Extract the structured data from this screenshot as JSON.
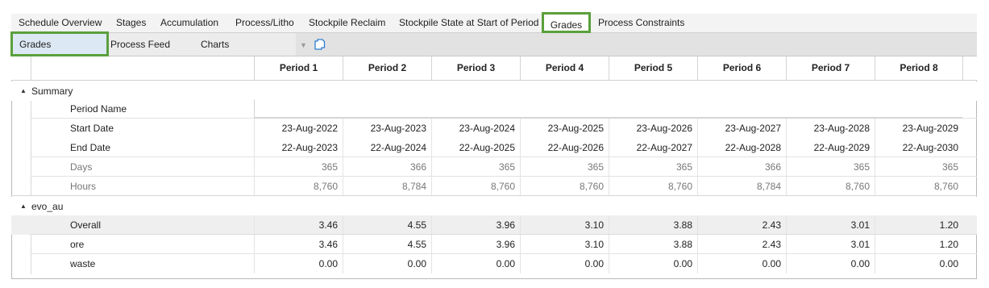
{
  "top_tabs": [
    {
      "label": "Schedule Overview",
      "active": false
    },
    {
      "label": "Stages",
      "active": false
    },
    {
      "label": "Accumulation",
      "active": false
    },
    {
      "label": "Process/Litho",
      "active": false
    },
    {
      "label": "Stockpile Reclaim",
      "active": false
    },
    {
      "label": "Stockpile State at Start of Period",
      "active": false
    },
    {
      "label": "Grades",
      "active": true
    },
    {
      "label": "Process Constraints",
      "active": false
    }
  ],
  "sub_tabs": [
    {
      "label": "Grades",
      "active": true
    },
    {
      "label": "Process Feed",
      "active": false
    },
    {
      "label": "Charts",
      "active": false
    }
  ],
  "toolbar": {
    "copy_icon": "copy-icon",
    "filter_icon": "filter-icon"
  },
  "columns": [
    "Period 1",
    "Period 2",
    "Period 3",
    "Period 4",
    "Period 5",
    "Period 6",
    "Period 7",
    "Period 8"
  ],
  "groups": {
    "summary": {
      "name": "Summary",
      "rows": {
        "period_name": {
          "label": "Period Name",
          "values": [
            "",
            "",
            "",
            "",
            "",
            "",
            "",
            ""
          ]
        },
        "start_date": {
          "label": "Start Date",
          "values": [
            "23-Aug-2022",
            "23-Aug-2023",
            "23-Aug-2024",
            "23-Aug-2025",
            "23-Aug-2026",
            "23-Aug-2027",
            "23-Aug-2028",
            "23-Aug-2029"
          ]
        },
        "end_date": {
          "label": "End Date",
          "values": [
            "22-Aug-2023",
            "22-Aug-2024",
            "22-Aug-2025",
            "22-Aug-2026",
            "22-Aug-2027",
            "22-Aug-2028",
            "22-Aug-2029",
            "22-Aug-2030"
          ]
        },
        "days": {
          "label": "Days",
          "values": [
            "365",
            "366",
            "365",
            "365",
            "365",
            "366",
            "365",
            "365"
          ]
        },
        "hours": {
          "label": "Hours",
          "values": [
            "8,760",
            "8,784",
            "8,760",
            "8,760",
            "8,760",
            "8,784",
            "8,760",
            "8,760"
          ]
        }
      }
    },
    "evo_au": {
      "name": "evo_au",
      "rows": {
        "overall": {
          "label": "Overall",
          "values": [
            "3.46",
            "4.55",
            "3.96",
            "3.10",
            "3.88",
            "2.43",
            "3.01",
            "1.20"
          ]
        },
        "ore": {
          "label": "ore",
          "values": [
            "3.46",
            "4.55",
            "3.96",
            "3.10",
            "3.88",
            "2.43",
            "3.01",
            "1.20"
          ]
        },
        "waste": {
          "label": "waste",
          "values": [
            "0.00",
            "0.00",
            "0.00",
            "0.00",
            "0.00",
            "0.00",
            "0.00",
            "0.00"
          ]
        }
      }
    }
  },
  "colors": {
    "accent_border": "#5aa03c",
    "selected_subtab": "#dce9f5"
  }
}
